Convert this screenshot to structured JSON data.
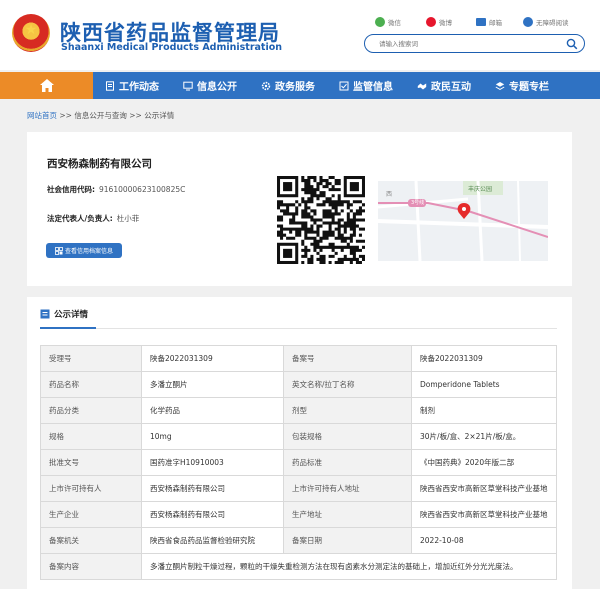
{
  "header": {
    "title_cn": "陕西省药品监督管理局",
    "title_en": "Shaanxi Medical Products Administration",
    "quick_links": [
      {
        "icon": "wechat-icon",
        "label": "微信",
        "color": "#4caf50"
      },
      {
        "icon": "weibo-icon",
        "label": "微博",
        "color": "#e6162d"
      },
      {
        "icon": "mail-icon",
        "label": "邮箱",
        "color": "#2f72c3"
      },
      {
        "icon": "accessibility-icon",
        "label": "无障碍阅读",
        "color": "#2f72c3"
      }
    ],
    "search_placeholder": "请输入搜索词"
  },
  "nav": {
    "home_icon": "home-icon",
    "items": [
      {
        "label": "工作动态",
        "icon": "document-icon"
      },
      {
        "label": "信息公开",
        "icon": "monitor-icon"
      },
      {
        "label": "政务服务",
        "icon": "gear-icon"
      },
      {
        "label": "监管信息",
        "icon": "checklist-icon"
      },
      {
        "label": "政民互动",
        "icon": "handshake-icon"
      },
      {
        "label": "专题专栏",
        "icon": "layers-icon"
      }
    ]
  },
  "breadcrumb": {
    "home": "网站首页",
    "sep": ">>",
    "path1": "信息公开与查询",
    "path2": "公示详情"
  },
  "company": {
    "name": "西安杨森制药有限公司",
    "credit_code_label": "社会信用代码:",
    "credit_code": "91610000623100825C",
    "rep_label": "法定代表人/负责人:",
    "rep": "杜小菲",
    "qr_button": "查看信用档案信息",
    "map_label": "丰庆公园",
    "map_road": "3号线",
    "map_district": "西"
  },
  "details": {
    "title": "公示详情",
    "rows": [
      [
        "受理号",
        "陕备2022031309",
        "备案号",
        "陕备2022031309"
      ],
      [
        "药品名称",
        "多潘立酮片",
        "英文名称/拉丁名称",
        "Domperidone Tablets"
      ],
      [
        "药品分类",
        "化学药品",
        "剂型",
        "制剂"
      ],
      [
        "规格",
        "10mg",
        "包装规格",
        "30片/板/盒、2×21片/板/盒。"
      ],
      [
        "批准文号",
        "国药准字H10910003",
        "药品标准",
        "《中国药典》2020年版二部"
      ],
      [
        "上市许可持有人",
        "西安杨森制药有限公司",
        "上市许可持有人地址",
        "陕西省西安市高新区草堂科技产业基地"
      ],
      [
        "生产企业",
        "西安杨森制药有限公司",
        "生产地址",
        "陕西省西安市高新区草堂科技产业基地"
      ],
      [
        "备案机关",
        "陕西省食品药品监督检验研究院",
        "备案日期",
        "2022-10-08"
      ]
    ],
    "content_label": "备案内容",
    "content": "多潘立酮片制粒干燥过程，颗粒的干燥失重检测方法在现有卤素水分测定法的基础上，增加近红外分光光度法。"
  },
  "colors": {
    "brand": "#1d5fb1",
    "nav": "#2f72c3",
    "home_tab": "#ec8b27"
  }
}
